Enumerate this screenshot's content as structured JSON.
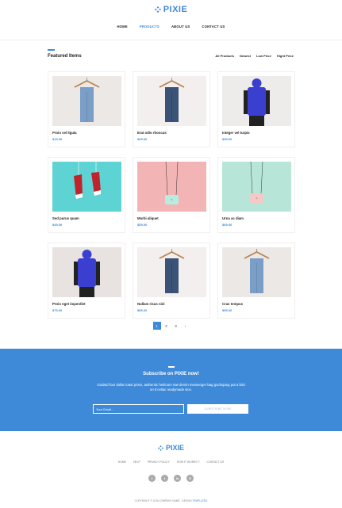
{
  "brand": {
    "name": "PIXIE",
    "accent": "#3f8ad8"
  },
  "nav": [
    {
      "label": "HOME",
      "active": false
    },
    {
      "label": "PRODUCTS",
      "active": true
    },
    {
      "label": "ABOUT US",
      "active": false
    },
    {
      "label": "CONTACT US",
      "active": false
    }
  ],
  "featured": {
    "title": "Featured Items",
    "filters": [
      "All Products",
      "Newest",
      "Low Price",
      "Hight Price"
    ]
  },
  "products": [
    {
      "name": "Proin vel ligula",
      "price": "$15.00",
      "image": "jeans-hanger"
    },
    {
      "name": "Erat odio rhoncus",
      "price": "$25.00",
      "image": "dark-jeans-hanger"
    },
    {
      "name": "Integer vel turpis",
      "price": "$35.00",
      "image": "blue-vest-front"
    },
    {
      "name": "Sed purus quam",
      "price": "$45.00",
      "image": "red-sneakers"
    },
    {
      "name": "Morbi aliquet",
      "price": "$55.00",
      "image": "mint-bag-pink-bg"
    },
    {
      "name": "Urna ac diam",
      "price": "$65.00",
      "image": "pink-bag-mint-bg"
    },
    {
      "name": "Proin eget imperdiet",
      "price": "$75.00",
      "image": "blue-vest-back"
    },
    {
      "name": "Nullam risus nisl",
      "price": "$85.00",
      "image": "dark-jeans-hanger"
    },
    {
      "name": "Cras tempus",
      "price": "$95.00",
      "image": "jeans-hanger"
    }
  ],
  "pagination": {
    "pages": [
      "1",
      "2",
      "3"
    ],
    "current": "1",
    "next": "›"
  },
  "subscribe": {
    "title": "Subscribe on PIXIE now!",
    "description": "Godard four dollar toast prism, authentic heirloom raw denim messenger bag gochujang put a bird on it celiac readymade vice.",
    "email_placeholder": "Your Email...",
    "button_label": "SUBSCRIBE NOW!"
  },
  "footer": {
    "links": [
      "HOME",
      "HELP",
      "PRIVACY POLICY",
      "HOW IT WORKS ?",
      "CONTACT US"
    ],
    "socials": [
      "f",
      "t",
      "in",
      "G"
    ],
    "copyright": "COPYRIGHT © 2016 COMPANY NAME - DESIGN",
    "copyright_link": "TEMPLATED"
  }
}
